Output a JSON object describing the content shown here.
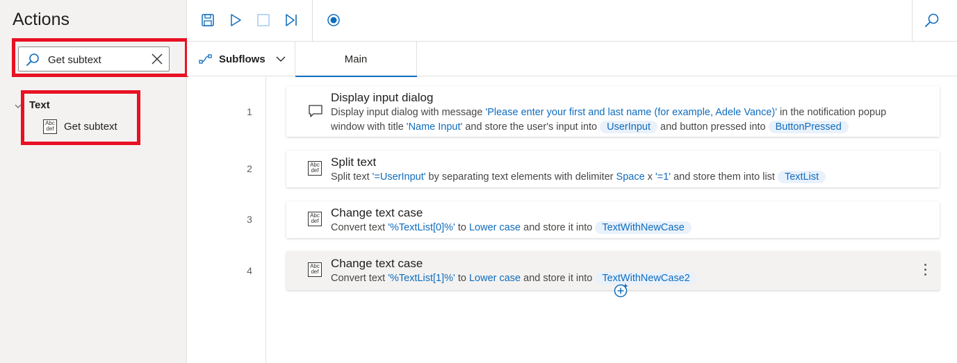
{
  "actions_pane": {
    "title": "Actions",
    "search": {
      "value": "Get subtext",
      "icon": "search-icon",
      "clear_icon": "close-icon"
    },
    "tree": {
      "group_label": "Text",
      "items": [
        {
          "label": "Get subtext",
          "icon": "abc-text-icon"
        }
      ]
    },
    "highlight_color": "#e81123"
  },
  "toolbar": {
    "buttons": [
      "save-icon",
      "run-icon",
      "stop-icon",
      "run-next-action-icon",
      "record-icon"
    ],
    "search_icon": "search-icon",
    "accent": "#0f6cbd"
  },
  "tabs": {
    "subflows_label": "Subflows",
    "main_label": "Main"
  },
  "steps": [
    {
      "line": "1",
      "title": "Display input dialog",
      "icon": "message-icon",
      "desc": {
        "t1": "Display input dialog with message ",
        "lit1": "'Please enter your first and last name (for example, Adele Vance)'",
        "t2": " in the notification popup window with title ",
        "lit2": "'Name Input'",
        "t3": " and store the user's input into ",
        "var1": "UserInput",
        "t4": " and button pressed into ",
        "var2": "ButtonPressed"
      }
    },
    {
      "line": "2",
      "title": "Split text",
      "icon": "abc-text-icon",
      "desc": {
        "t1": "Split text ",
        "lit1": "'=UserInput'",
        "t2": " by separating text elements with delimiter ",
        "lit2": "Space",
        "t3": " x ",
        "lit3": "'=1'",
        "t4": " and store them into list ",
        "var1": "TextList"
      }
    },
    {
      "line": "3",
      "title": "Change text case",
      "icon": "abc-text-icon",
      "desc": {
        "t1": "Convert text ",
        "lit1": "'%TextList[0]%'",
        "t2": " to ",
        "lit2": "Lower case",
        "t3": " and store it into ",
        "var1": "TextWithNewCase"
      }
    },
    {
      "line": "4",
      "title": "Change text case",
      "icon": "abc-text-icon",
      "desc": {
        "t1": "Convert text ",
        "lit1": "'%TextList[1]%'",
        "t2": " to ",
        "lit2": "Lower case",
        "t3": " and store it into ",
        "var1": "TextWithNewCase2"
      }
    }
  ],
  "abc_icon": {
    "top": "Abc",
    "bottom": "def"
  }
}
